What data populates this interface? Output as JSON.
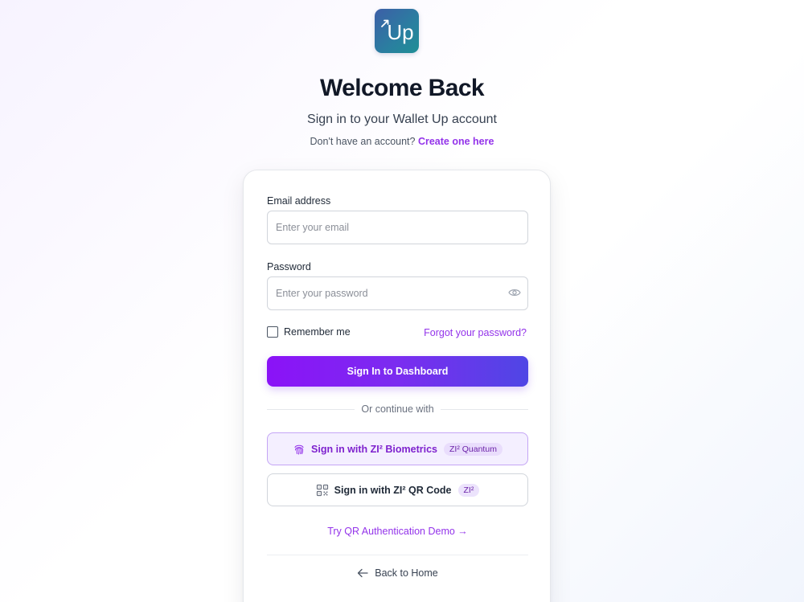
{
  "header": {
    "logo_text": "Up",
    "title": "Welcome Back",
    "subtitle": "Sign in to your Wallet Up account",
    "signup_prompt": "Don't have an account?",
    "signup_link": "Create one here"
  },
  "form": {
    "email_label": "Email address",
    "email_placeholder": "Enter your email",
    "email_value": "",
    "password_label": "Password",
    "password_placeholder": "Enter your password",
    "password_value": "",
    "remember_label": "Remember me",
    "remember_checked": false,
    "forgot_link": "Forgot your password?",
    "signin_button": "Sign In to Dashboard"
  },
  "alt_auth": {
    "divider_text": "Or continue with",
    "biometrics_button": "Sign in with ZI² Biometrics",
    "biometrics_badge": "ZI² Quantum",
    "qr_button": "Sign in with ZI² QR Code",
    "qr_badge": "ZI²",
    "demo_link": "Try QR Authentication Demo →",
    "back_home": "Back to Home"
  },
  "icons": {
    "logo": "wallet-up-logo",
    "eye": "eye-icon",
    "fingerprint": "fingerprint-icon",
    "qr": "qr-code-icon",
    "back": "arrow-left-icon"
  },
  "colors": {
    "accent": "#9333ea",
    "button_gradient_start": "#8b12f7",
    "button_gradient_end": "#4f46e5",
    "logo_gradient_start": "#3d5ea7",
    "logo_gradient_end": "#1f8f95"
  }
}
